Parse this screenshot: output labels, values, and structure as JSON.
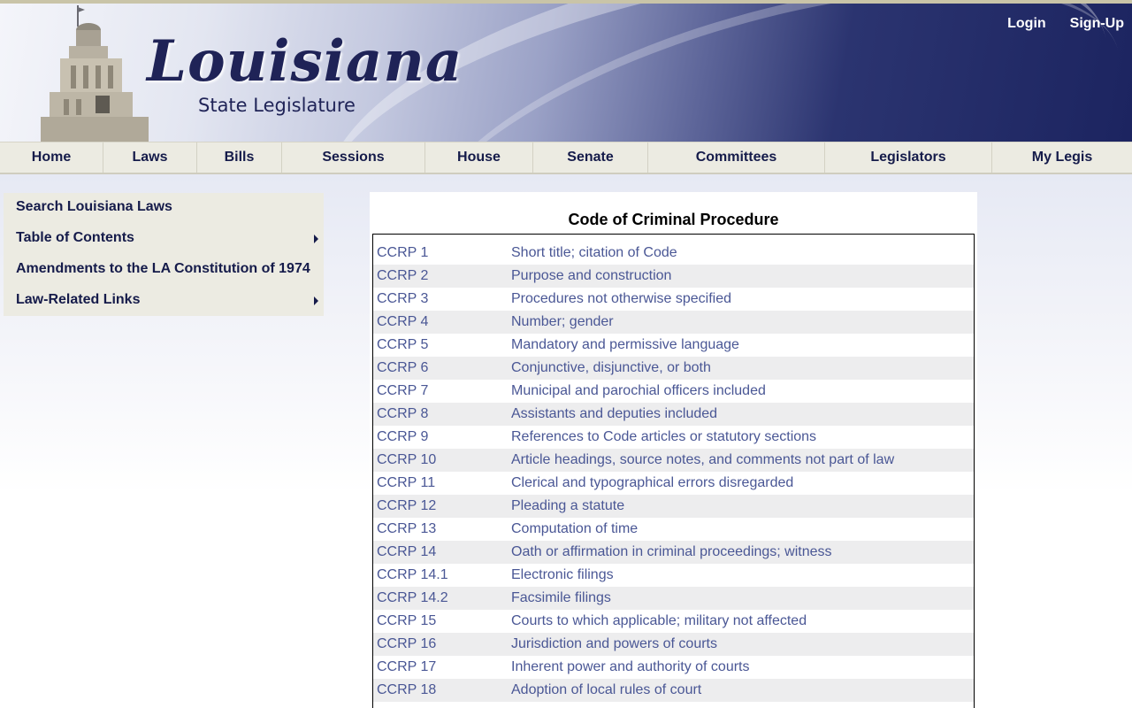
{
  "header": {
    "logo_main": "Louisiana",
    "logo_sub": "State Legislature",
    "login": "Login",
    "signup": "Sign-Up"
  },
  "nav": {
    "items": [
      "Home",
      "Laws",
      "Bills",
      "Sessions",
      "House",
      "Senate",
      "Committees",
      "Legislators",
      "My Legis"
    ]
  },
  "sidebar": {
    "items": [
      {
        "label": "Search Louisiana Laws",
        "has_submenu": false
      },
      {
        "label": "Table of Contents",
        "has_submenu": true
      },
      {
        "label": "Amendments to the LA Constitution of 1974",
        "has_submenu": false
      },
      {
        "label": "Law-Related Links",
        "has_submenu": true
      }
    ]
  },
  "content": {
    "title": "Code of Criminal Procedure",
    "rows": [
      {
        "num": "CCRP 1",
        "title": "Short title; citation of Code"
      },
      {
        "num": "CCRP 2",
        "title": "Purpose and construction"
      },
      {
        "num": "CCRP 3",
        "title": "Procedures not otherwise specified"
      },
      {
        "num": "CCRP 4",
        "title": "Number; gender"
      },
      {
        "num": "CCRP 5",
        "title": "Mandatory and permissive language"
      },
      {
        "num": "CCRP 6",
        "title": "Conjunctive, disjunctive, or both"
      },
      {
        "num": "CCRP 7",
        "title": "Municipal and parochial officers included"
      },
      {
        "num": "CCRP 8",
        "title": "Assistants and deputies included"
      },
      {
        "num": "CCRP 9",
        "title": "References to Code articles or statutory sections"
      },
      {
        "num": "CCRP 10",
        "title": "Article headings, source notes, and comments not part of law"
      },
      {
        "num": "CCRP 11",
        "title": "Clerical and typographical errors disregarded"
      },
      {
        "num": "CCRP 12",
        "title": "Pleading a statute"
      },
      {
        "num": "CCRP 13",
        "title": "Computation of time"
      },
      {
        "num": "CCRP 14",
        "title": "Oath or affirmation in criminal proceedings; witness"
      },
      {
        "num": "CCRP 14.1",
        "title": "Electronic filings"
      },
      {
        "num": "CCRP 14.2",
        "title": "Facsimile filings"
      },
      {
        "num": "CCRP 15",
        "title": "Courts to which applicable; military not affected"
      },
      {
        "num": "CCRP 16",
        "title": "Jurisdiction and powers of courts"
      },
      {
        "num": "CCRP 17",
        "title": "Inherent power and authority of courts"
      },
      {
        "num": "CCRP 18",
        "title": "Adoption of local rules of court"
      }
    ]
  }
}
